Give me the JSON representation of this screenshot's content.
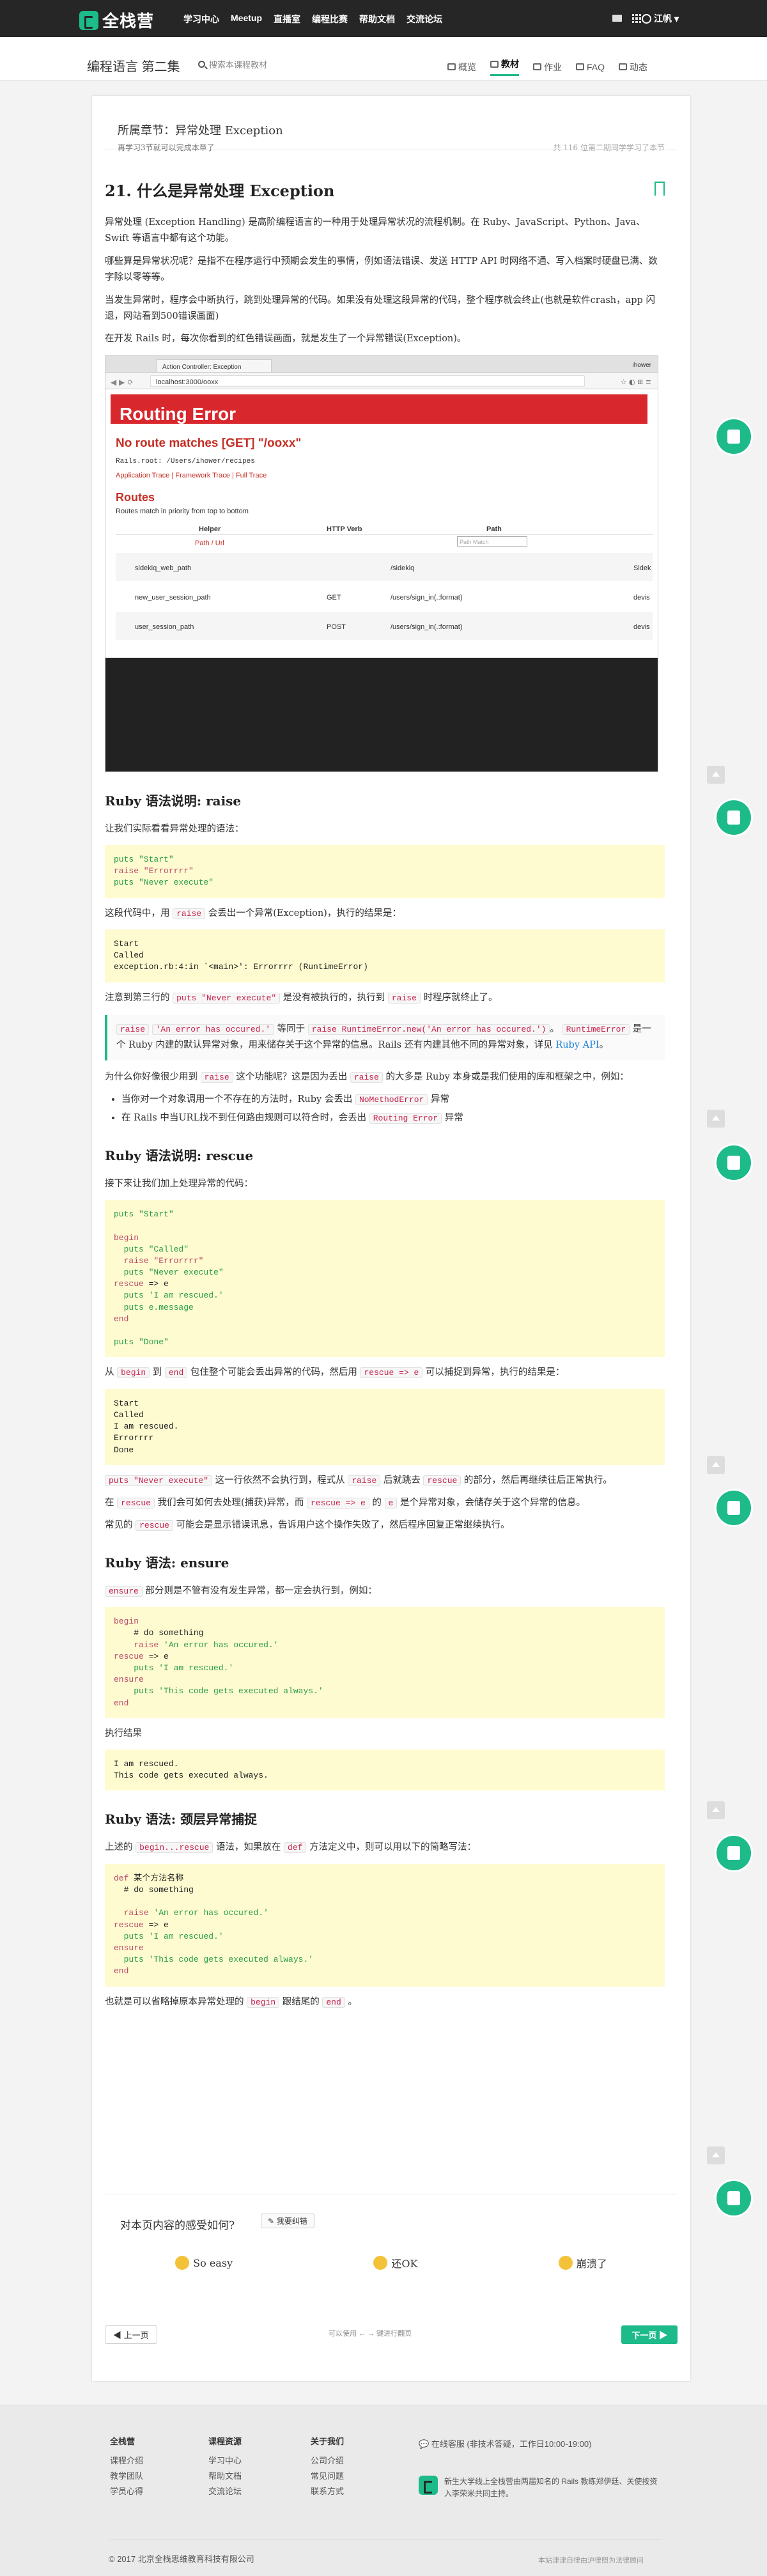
{
  "header": {
    "logo": "全栈营",
    "nav": [
      "学习中心",
      "Meetup",
      "直播室",
      "编程比赛",
      "帮助文档",
      "交流论坛"
    ],
    "user": "江帆"
  },
  "subheader": {
    "course": "编程语言 第二集",
    "search_placeholder": "搜索本课程教材",
    "tabs": [
      "概览",
      "教材",
      "作业",
      "FAQ",
      "动态"
    ]
  },
  "chapter": {
    "title": "所属章节：异常处理 Exception",
    "time": "再学习3节就可以完成本章了",
    "count": "共 116 位第二期同学学习了本节"
  },
  "article": {
    "title": "21. 什么是异常处理 Exception",
    "p1": "异常处理 (Exception Handling) 是高阶编程语言的一种用于处理异常状况的流程机制。在 Ruby、JavaScript、Python、Java、Swift 等语言中都有这个功能。",
    "p2": "哪些算是异常状况呢？是指不在程序运行中预期会发生的事情，例如语法错误、发送 HTTP API 时网络不通、写入档案时硬盘已满、数字除以零等等。",
    "p3": "当发生异常时，程序会中断执行，跳到处理异常的代码。如果没有处理这段异常的代码，整个程序就会终止(也就是软件crash，app 闪退，网站看到500错误画面)",
    "p4": "在开发 Rails 时，每次你看到的红色错误画面，就是发生了一个异常错误(Exception)。",
    "shot": {
      "tab": "Action Controller: Exception",
      "url": "localhost:3000/ooxx",
      "profile": "ihower",
      "banner": "Routing Error",
      "headline": "No route matches [GET] \"/ooxx\"",
      "rails_root": "Rails.root: /Users/ihower/recipes",
      "links": "Application Trace | Framework Trace | Full Trace",
      "routes": "Routes",
      "routes_sub": "Routes match in priority from top to bottom",
      "cols": [
        "Helper",
        "HTTP Verb",
        "Path"
      ],
      "helper_sub": "Path / Url",
      "path_placeholder": "Path Match",
      "rows": [
        [
          "sidekiq_web_path",
          "",
          "/sidekiq",
          "Sidek"
        ],
        [
          "new_user_session_path",
          "GET",
          "/users/sign_in(.:format)",
          "devis"
        ],
        [
          "user_session_path",
          "POST",
          "/users/sign_in(.:format)",
          "devis"
        ]
      ]
    },
    "raise_h": "Ruby 语法说明: raise",
    "raise_p": "让我们实际看看异常处理的语法：",
    "raise_after_a": "这段代码中，用",
    "raise_after_b": "会丢出一个异常(Exception)，执行的结果是：",
    "raise_kw": "raise",
    "raise_out": "Start\nCalled\nexception.rb:4:in `<main>': Errorrrr (RuntimeError)",
    "raise_note_a": "注意到第三行的",
    "raise_note_b": "是没有被执行的，执行到",
    "raise_note_c": "时程序就终止了。",
    "puts_never": "puts \"Never execute\"",
    "quote_a": "'An error has occured.'",
    "quote_b": "等同于",
    "quote_c": "raise RuntimeError.new('An error has occured.')",
    "quote_d": "。",
    "quote_e": "RuntimeError",
    "quote_f": "是一个 Ruby 内建的默认异常对象，用来储存关于这个异常的信息。Rails 还有内建其他不同的异常对象，详见",
    "quote_link": "Ruby API",
    "why_a": "为什么你好像很少用到",
    "why_b": "这个功能呢？这是因为丢出",
    "why_c": "的大多是 Ruby 本身或是我们使用的库和框架之中，例如：",
    "li1_a": "当你对一个对象调用一个不存在的方法时，Ruby 会丢出",
    "li1_b": "NoMethodError",
    "li1_c": "异常",
    "li2_a": "在 Rails 中当URL找不到任何路由规则可以符合时，会丢出",
    "li2_b": "Routing Error",
    "li2_c": "异常",
    "rescue_h": "Ruby 语法说明: rescue",
    "rescue_p": "接下来让我们加上处理异常的代码：",
    "rescue_out": "Start\nCalled\nI am rescued.\nErrorrrr\nDone",
    "from_a": "从",
    "from_b": "begin",
    "from_c": "到",
    "from_d": "end",
    "from_e": "包住整个可能会丢出异常的代码，然后用",
    "from_f": "rescue => e",
    "from_g": "可以捕捉到异常，执行的结果是：",
    "still_a": "这一行依然不会执行到，程式从",
    "still_b": "后就跳去",
    "still_c": "rescue",
    "still_d": "的部分，然后再继续往后正常执行。",
    "in_a": "在",
    "in_b": "我们会可如何去处理(捕获)异常，而",
    "in_c": "的",
    "in_d": "e",
    "in_e": "是个异常对象，会储存关于这个异常的信息。",
    "common_a": "常见的",
    "common_b": "可能会是显示错误讯息，告诉用户这个操作失败了，然后程序回复正常继续执行。",
    "ensure_h": "Ruby 语法: ensure",
    "ensure_kw": "ensure",
    "ensure_p": "部分则是不管有没有发生异常，都一定会执行到，例如：",
    "ensure_res": "执行结果",
    "ensure_out": "I am rescued.\nThis code gets executed always.",
    "method_h": "Ruby 语法: 颈层异常捕捉",
    "method_a": "上述的",
    "method_b": "begin...rescue",
    "method_c": "语法，如果放在",
    "method_d": "def",
    "method_e": "方法定义中，则可以用以下的简略写法：",
    "omit_a": "也就是可以省略掉原本异常处理的",
    "omit_b": "begin",
    "omit_c": "跟结尾的",
    "omit_d": "end",
    "omit_e": "。"
  },
  "feedback": {
    "question": "对本页内容的感受如何?",
    "button": "我要纠错",
    "options": [
      "So easy",
      "还OK",
      "崩溃了"
    ]
  },
  "pager": {
    "prev": "上一页",
    "hint": "可以使用 ← → 键进行翻页",
    "next": "下一页"
  },
  "footer": {
    "col1": {
      "title": "全栈营",
      "items": [
        "课程介绍",
        "教学团队",
        "学员心得"
      ]
    },
    "col2": {
      "title": "课程资源",
      "items": [
        "学习中心",
        "帮助文档",
        "交流论坛"
      ]
    },
    "col3": {
      "title": "关于我们",
      "items": [
        "公司介绍",
        "常见问题",
        "联系方式"
      ]
    },
    "service": "在线客服 (非技术答疑，工作日10:00-19:00)",
    "desc": "新生大学线上全栈营由两届知名的 Rails 教练郑伊廷、关使按资入李荣米共同主持。",
    "copyright": "© 2017 北京全栈思维教育科技有限公司",
    "right": "本站津津自律由沪律照为法律顾问"
  },
  "colors": {
    "accent": "#1dba8a",
    "topbar": "#262626",
    "code_bg": "#fffbd0",
    "error_red": "#d9272e"
  }
}
